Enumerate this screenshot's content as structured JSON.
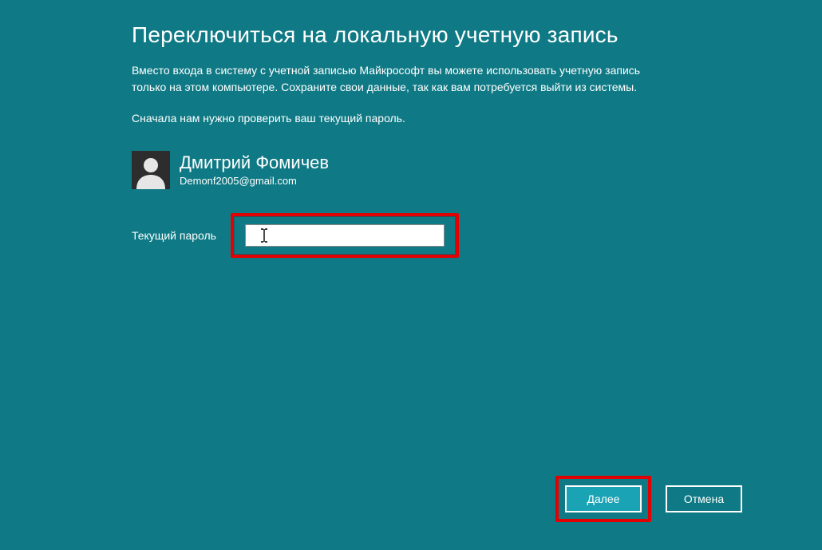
{
  "title": "Переключиться на локальную учетную запись",
  "description": "Вместо входа в систему с учетной записью Майкрософт вы можете использовать учетную запись только на этом компьютере. Сохраните свои данные, так как вам потребуется выйти из системы.",
  "instruction": "Сначала нам нужно проверить ваш текущий пароль.",
  "user": {
    "name": "Дмитрий Фомичев",
    "email": "Demonf2005@gmail.com"
  },
  "form": {
    "password_label": "Текущий пароль",
    "password_value": ""
  },
  "buttons": {
    "next": "Далее",
    "cancel": "Отмена"
  }
}
